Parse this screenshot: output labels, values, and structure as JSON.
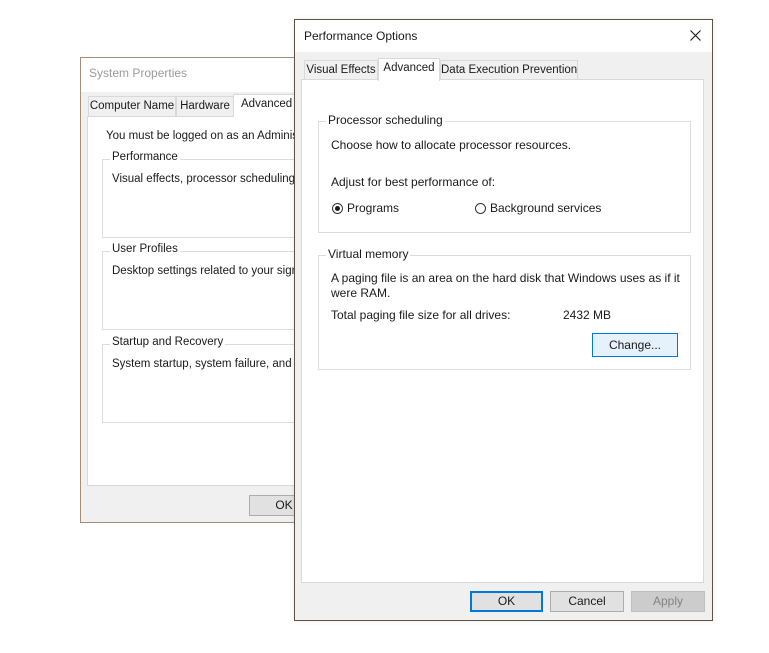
{
  "system_properties": {
    "title": "System Properties",
    "tabs": [
      {
        "label": "Computer Name",
        "active": false
      },
      {
        "label": "Hardware",
        "active": false
      },
      {
        "label": "Advanced",
        "active": true
      }
    ],
    "admin_notice": "You must be logged on as an Administra",
    "groups": [
      {
        "label": "Performance",
        "description": "Visual effects, processor scheduling, m"
      },
      {
        "label": "User Profiles",
        "description": "Desktop settings related to your sign-in"
      },
      {
        "label": "Startup and Recovery",
        "description": "System startup, system failure, and deb"
      }
    ],
    "ok_label": "OK"
  },
  "performance_options": {
    "title": "Performance Options",
    "close_icon": "close-icon",
    "tabs": [
      {
        "label": "Visual Effects",
        "active": false
      },
      {
        "label": "Advanced",
        "active": true
      },
      {
        "label": "Data Execution Prevention",
        "active": false
      }
    ],
    "processor_scheduling": {
      "label": "Processor scheduling",
      "description": "Choose how to allocate processor resources.",
      "adjust_label": "Adjust for best performance of:",
      "options": [
        {
          "label": "Programs",
          "selected": true
        },
        {
          "label": "Background services",
          "selected": false
        }
      ]
    },
    "virtual_memory": {
      "label": "Virtual memory",
      "description_line1": "A paging file is an area on the hard disk that Windows uses as if it",
      "description_line2": "were RAM.",
      "total_label": "Total paging file size for all drives:",
      "total_value": "2432 MB",
      "change_label": "Change..."
    },
    "buttons": {
      "ok": "OK",
      "cancel": "Cancel",
      "apply": "Apply"
    },
    "colors": {
      "accent": "#0078d7",
      "disabled_text": "#838383"
    }
  }
}
